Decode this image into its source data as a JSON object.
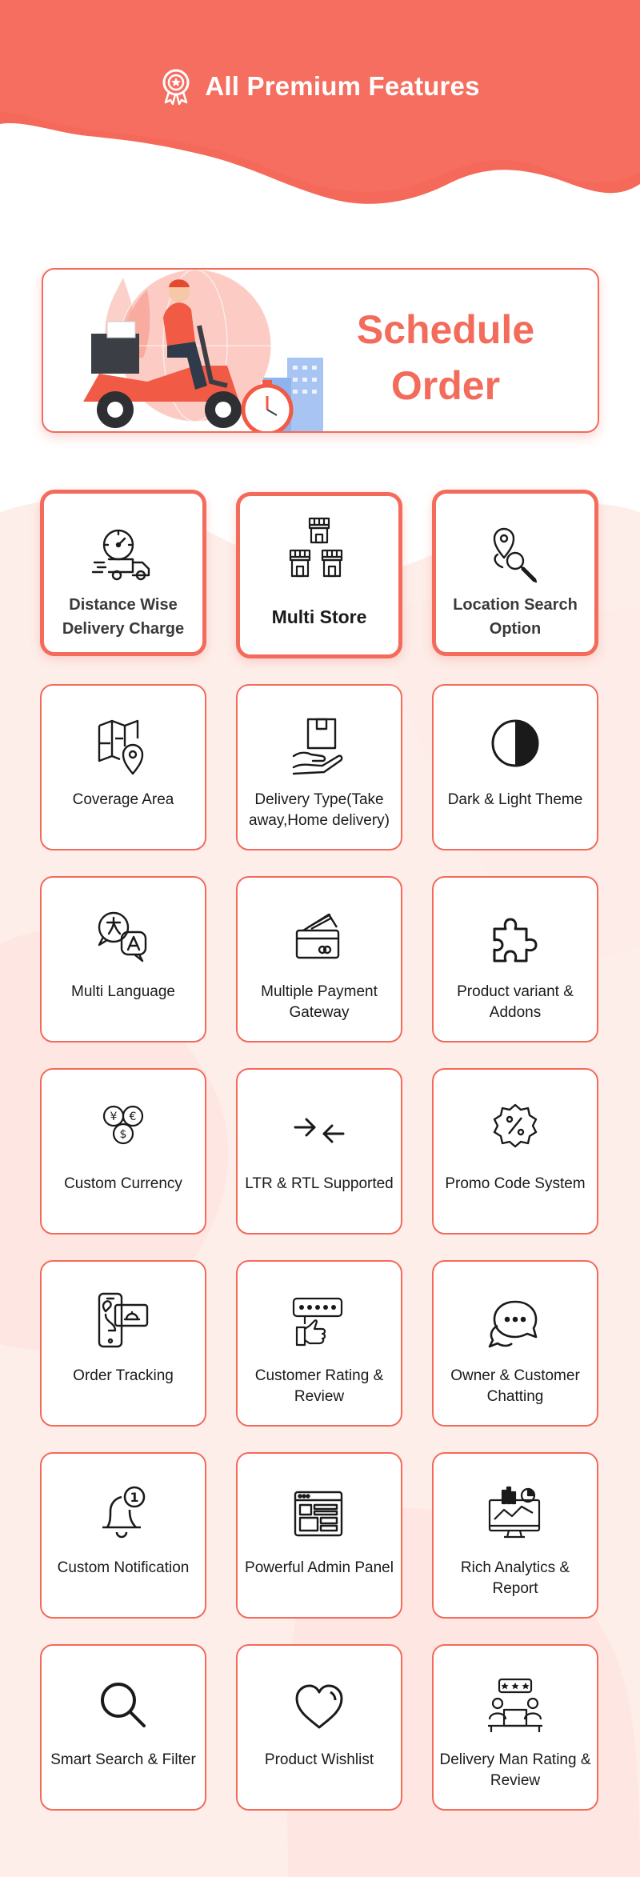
{
  "header": {
    "title": "All Premium Features",
    "badge_icon": "award-badge-icon"
  },
  "hero": {
    "title_line1": "Schedule",
    "title_line2": "Order",
    "illustration": "delivery-scooter-illustration"
  },
  "colors": {
    "accent": "#f26b5b",
    "accent_light": "#fdeeea",
    "text": "#1a1a1a"
  },
  "features": [
    {
      "label": "Distance Wise Delivery Charge",
      "icon": "delivery-truck-speed-icon"
    },
    {
      "label": "Multi Store",
      "icon": "multi-store-icon"
    },
    {
      "label": "Location Search Option",
      "icon": "location-search-icon"
    },
    {
      "label": "Coverage Area",
      "icon": "map-pin-icon"
    },
    {
      "label": "Delivery Type(Take away,Home delivery)",
      "icon": "package-hand-icon"
    },
    {
      "label": "Dark & Light Theme",
      "icon": "contrast-icon"
    },
    {
      "label": "Multi Language",
      "icon": "translate-icon"
    },
    {
      "label": "Multiple Payment Gateway",
      "icon": "credit-card-icon"
    },
    {
      "label": "Product variant & Addons",
      "icon": "puzzle-icon"
    },
    {
      "label": "Custom Currency",
      "icon": "currency-icon"
    },
    {
      "label": "LTR & RTL Supported",
      "icon": "arrows-inward-icon"
    },
    {
      "label": "Promo Code System",
      "icon": "discount-badge-icon"
    },
    {
      "label": "Order Tracking",
      "icon": "phone-tracking-icon"
    },
    {
      "label": "Customer Rating & Review",
      "icon": "rating-thumb-icon"
    },
    {
      "label": "Owner & Customer Chatting",
      "icon": "chat-bubbles-icon"
    },
    {
      "label": "Custom Notification",
      "icon": "bell-notification-icon"
    },
    {
      "label": "Powerful Admin Panel",
      "icon": "admin-dashboard-icon"
    },
    {
      "label": "Rich Analytics & Report",
      "icon": "analytics-monitor-icon"
    },
    {
      "label": "Smart Search & Filter",
      "icon": "search-icon"
    },
    {
      "label": "Product Wishlist",
      "icon": "heart-icon"
    },
    {
      "label": "Delivery Man Rating & Review",
      "icon": "delivery-rating-icon"
    }
  ]
}
